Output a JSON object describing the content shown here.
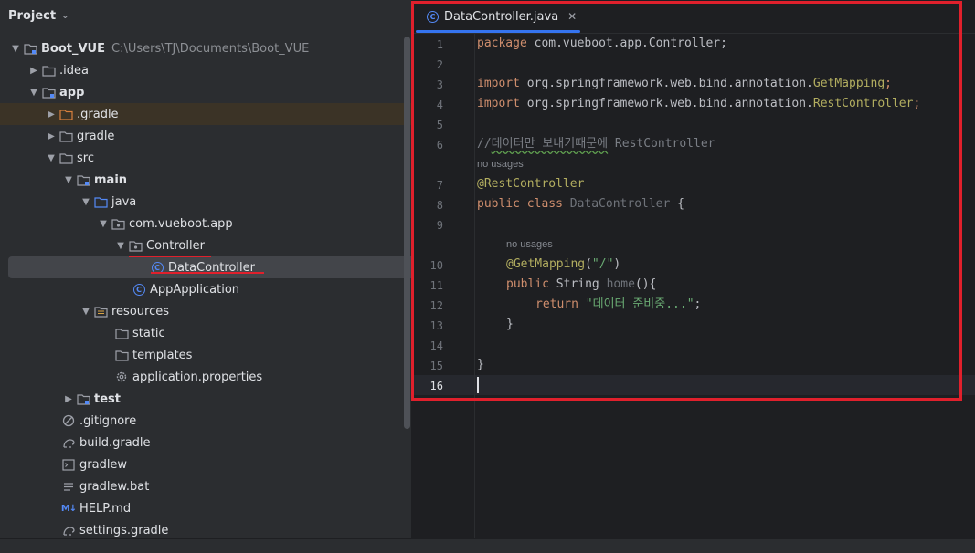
{
  "panel": {
    "title": "Project"
  },
  "tree": {
    "root": {
      "label": "Boot_VUE",
      "path": "C:\\Users\\TJ\\Documents\\Boot_VUE"
    },
    "idea": ".idea",
    "app": "app",
    "dot_gradle": ".gradle",
    "gradle": "gradle",
    "src": "src",
    "main": "main",
    "java": "java",
    "package": "com.vueboot.app",
    "controller_folder": "Controller",
    "data_controller": "DataController",
    "app_application": "AppApplication",
    "resources": "resources",
    "static": "static",
    "templates": "templates",
    "application_properties": "application.properties",
    "test": "test",
    "gitignore": ".gitignore",
    "build_gradle": "build.gradle",
    "gradlew": "gradlew",
    "gradlew_bat": "gradlew.bat",
    "help_md": "HELP.md",
    "settings_gradle": "settings.gradle"
  },
  "editor": {
    "tab_label": "DataController.java",
    "line_numbers": [
      "1",
      "2",
      "3",
      "4",
      "5",
      "6",
      "7",
      "8",
      "9",
      "10",
      "11",
      "12",
      "13",
      "14",
      "15",
      "16"
    ],
    "hint_no_usages": "no usages",
    "code": {
      "l1": {
        "kw": "package",
        "rest": " com.vueboot.app.Controller;"
      },
      "l3": {
        "kw": "import",
        "pkg": " org.springframework.web.bind.annotation.",
        "cls": "GetMapping",
        "end": ";"
      },
      "l4": {
        "kw": "import",
        "pkg": " org.springframework.web.bind.annotation.",
        "cls": "RestController",
        "end": ";"
      },
      "l6": {
        "slash": "//",
        "korean": "데이터만 보내기때문에",
        "rest": " RestController"
      },
      "l7": {
        "ann": "@RestController"
      },
      "l8": {
        "kw": "public class",
        "name": " DataController",
        "rest": " {"
      },
      "l10": {
        "ann": "@GetMapping",
        "rest": "(",
        "str": "\"/\"",
        "end": ")"
      },
      "l11": {
        "kw": "public",
        "type": " String",
        "name": " home",
        "rest": "(){"
      },
      "l12": {
        "kw": "return",
        "str": " \"데이터 준비중...\"",
        "end": ";"
      },
      "l13": {
        "text": "}"
      },
      "l15": {
        "text": "}"
      }
    }
  },
  "colors": {
    "accent": "#3574f0",
    "highlight_red": "#e0202c",
    "keyword": "#cf8e6d",
    "annotation": "#b3ae60",
    "string": "#6aab73"
  }
}
